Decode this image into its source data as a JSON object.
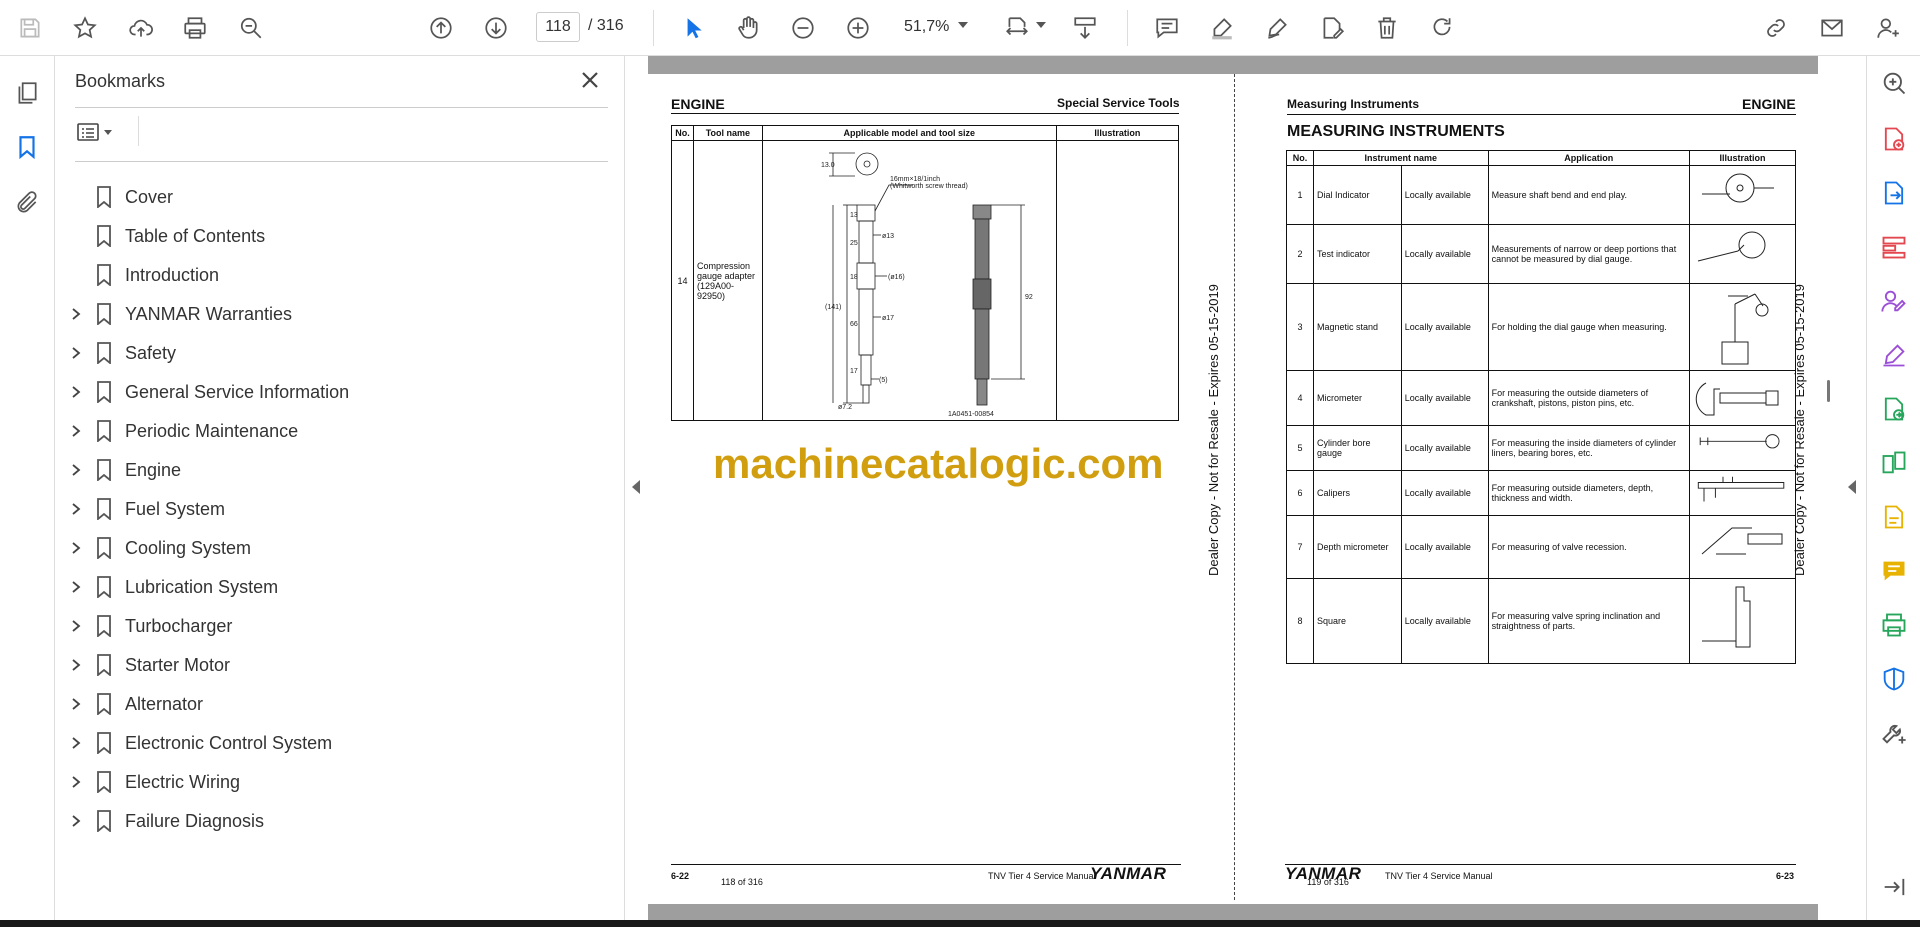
{
  "toolbar": {
    "current_page": "118",
    "total_pages": "/ 316",
    "zoom": "51,7%"
  },
  "bookmarks": {
    "title": "Bookmarks",
    "items": [
      {
        "label": "Cover",
        "expandable": false
      },
      {
        "label": "Table of Contents",
        "expandable": false
      },
      {
        "label": "Introduction",
        "expandable": false
      },
      {
        "label": "YANMAR Warranties",
        "expandable": true
      },
      {
        "label": "Safety",
        "expandable": true
      },
      {
        "label": "General Service Information",
        "expandable": true
      },
      {
        "label": "Periodic Maintenance",
        "expandable": true
      },
      {
        "label": "Engine",
        "expandable": true
      },
      {
        "label": "Fuel System",
        "expandable": true
      },
      {
        "label": "Cooling System",
        "expandable": true
      },
      {
        "label": "Lubrication System",
        "expandable": true
      },
      {
        "label": "Turbocharger",
        "expandable": true
      },
      {
        "label": "Starter Motor",
        "expandable": true
      },
      {
        "label": "Alternator",
        "expandable": true
      },
      {
        "label": "Electronic Control System",
        "expandable": true
      },
      {
        "label": "Electric Wiring",
        "expandable": true
      },
      {
        "label": "Failure Diagnosis",
        "expandable": true
      }
    ]
  },
  "left_page": {
    "header_left": "ENGINE",
    "header_right": "Special Service Tools",
    "table_headers": [
      "No.",
      "Tool name",
      "Applicable model and tool size",
      "Illustration"
    ],
    "row": {
      "no": "14",
      "name": "Compression gauge adapter (129A00-92950)"
    },
    "drawing_labels": {
      "thread": "16mm×18/1inch",
      "thread2": "(Whitworth screw thread)",
      "d13": "ø13",
      "d16": "(ø16)",
      "d17": "ø17",
      "d72": "ø7.2",
      "d5": "(5)",
      "d1": "(1)",
      "l141": "(141)",
      "l13": "13",
      "l25": "25",
      "l18": "18",
      "l66": "66",
      "l17": "17",
      "l5b": "5",
      "l130": "13.0",
      "l92": "92",
      "code": "1A0451-00854"
    },
    "footer_page": "6-22",
    "footer_count": "118 of 316",
    "footer_manual": "TNV Tier 4 Service Manual",
    "brand": "YANMAR"
  },
  "right_page": {
    "header_left": "Measuring Instruments",
    "header_right": "ENGINE",
    "title": "MEASURING INSTRUMENTS",
    "table_headers": [
      "No.",
      "Instrument name",
      "Application",
      "Illustration"
    ],
    "rows": [
      {
        "no": "1",
        "name": "Dial Indicator",
        "avail": "Locally available",
        "app": "Measure shaft bend and end play."
      },
      {
        "no": "2",
        "name": "Test indicator",
        "avail": "Locally available",
        "app": "Measurements of narrow or deep portions that cannot be measured by dial gauge."
      },
      {
        "no": "3",
        "name": "Magnetic stand",
        "avail": "Locally available",
        "app": "For holding the dial gauge when measuring."
      },
      {
        "no": "4",
        "name": "Micrometer",
        "avail": "Locally available",
        "app": "For measuring the outside diameters of crankshaft, pistons, piston pins, etc."
      },
      {
        "no": "5",
        "name": "Cylinder bore gauge",
        "avail": "Locally available",
        "app": "For measuring the inside diameters of cylinder liners, bearing bores, etc."
      },
      {
        "no": "6",
        "name": "Calipers",
        "avail": "Locally available",
        "app": "For measuring outside diameters, depth, thickness and width."
      },
      {
        "no": "7",
        "name": "Depth micrometer",
        "avail": "Locally available",
        "app": "For measuring of valve recession."
      },
      {
        "no": "8",
        "name": "Square",
        "avail": "Locally available",
        "app": "For measuring valve spring inclination and straightness of parts."
      }
    ],
    "footer_page": "6-23",
    "footer_count": "119 of 316",
    "footer_manual": "TNV Tier 4 Service Manual",
    "brand": "YANMAR"
  },
  "watermark": "machinecatalogic.com",
  "dealer_stamp": "Dealer Copy - Not for Resale - Expires 05-15-2019",
  "colors": {
    "accent_blue": "#1473e6",
    "watermark": "#d19e10",
    "red_tool": "#e34850",
    "purple_tool": "#9b4fd6",
    "green_tool": "#26a65b",
    "yellow_tool": "#e8b200"
  }
}
